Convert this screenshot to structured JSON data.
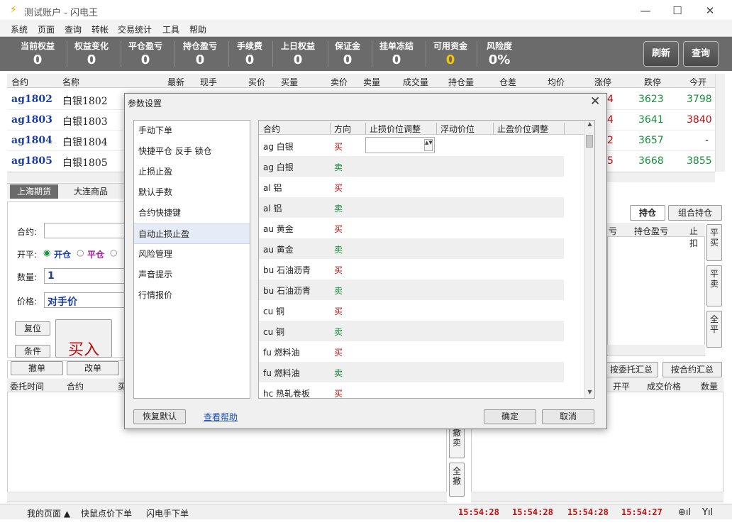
{
  "app": {
    "title": "测试账户 - 闪电王"
  },
  "menu": [
    "系统",
    "页面",
    "查询",
    "转帐",
    "交易统计",
    "工具",
    "帮助"
  ],
  "stats": [
    {
      "label": "当前权益",
      "value": "0"
    },
    {
      "label": "权益变化",
      "value": "0"
    },
    {
      "label": "平仓盈亏",
      "value": "0"
    },
    {
      "label": "持仓盈亏",
      "value": "0"
    },
    {
      "label": "手续费",
      "value": "0"
    },
    {
      "label": "上日权益",
      "value": "0"
    },
    {
      "label": "保证金",
      "value": "0"
    },
    {
      "label": "挂单冻结",
      "value": "0"
    },
    {
      "label": "可用资金",
      "value": "0"
    },
    {
      "label": "风险度",
      "value": "0%"
    }
  ],
  "dash_buttons": {
    "refresh": "刷新",
    "query": "查询"
  },
  "quote": {
    "headers": [
      "合约",
      "名称",
      "最新",
      "现手",
      "买价",
      "买量",
      "卖价",
      "卖量",
      "成交量",
      "持仓量",
      "仓差",
      "均价",
      "涨停",
      "跌停",
      "今开"
    ],
    "rows": [
      {
        "code": "ag1802",
        "name": "白银1802",
        "up": "4",
        "down": "3623",
        "open": "3798"
      },
      {
        "code": "ag1803",
        "name": "白银1803",
        "up": "4",
        "down": "3641",
        "open": "3840"
      },
      {
        "code": "ag1804",
        "name": "白银1804",
        "up": "2",
        "down": "3657",
        "open": "-"
      },
      {
        "code": "ag1805",
        "name": "白银1805",
        "up": "5",
        "down": "3668",
        "open": "3855"
      }
    ]
  },
  "market_tabs": [
    "上海期货",
    "大连商品"
  ],
  "order": {
    "contract_label": "合约:",
    "openclose_label": "开平:",
    "open": "开仓",
    "close": "平仓",
    "qty_label": "数量:",
    "qty": "1",
    "price_label": "价格:",
    "price": "对手价",
    "reset": "复位",
    "cond": "条件",
    "buy": "买入"
  },
  "pos_tabs": [
    "持仓",
    "组合持仓"
  ],
  "pos_headers": [
    "亏",
    "持仓盈亏",
    "止扣"
  ],
  "side_buttons": [
    "平买",
    "平卖",
    "全平"
  ],
  "order_buttons": [
    "撤单",
    "改单"
  ],
  "order_headers": [
    "委托时间",
    "合约",
    "买"
  ],
  "cancel_buttons": [
    "撤卖",
    "全撤"
  ],
  "trade_tabs": [
    "按委托汇总",
    "按合约汇总"
  ],
  "trade_headers": [
    "开平",
    "成交价格",
    "数量"
  ],
  "status": {
    "items": [
      "我的页面 ▲",
      "快鼠点价下单",
      "闪电手下单"
    ],
    "times": [
      "15:54:28",
      "15:54:28",
      "15:54:28",
      "15:54:27"
    ]
  },
  "dialog": {
    "title": "参数设置",
    "menu": [
      "手动下单",
      "快捷平仓 反手 锁仓",
      "止损止盈",
      "默认手数",
      "合约快捷键",
      "自动止损止盈",
      "风险管理",
      "声音提示",
      "行情报价"
    ],
    "selected": 5,
    "grid_headers": [
      "合约",
      "方向",
      "止损价位调整",
      "浮动价位",
      "止盈价位调整"
    ],
    "rows": [
      {
        "contract": "ag 白银",
        "dir": "买"
      },
      {
        "contract": "ag 白银",
        "dir": "卖"
      },
      {
        "contract": "al 铝",
        "dir": "买"
      },
      {
        "contract": "al 铝",
        "dir": "卖"
      },
      {
        "contract": "au 黄金",
        "dir": "买"
      },
      {
        "contract": "au 黄金",
        "dir": "卖"
      },
      {
        "contract": "bu 石油沥青",
        "dir": "买"
      },
      {
        "contract": "bu 石油沥青",
        "dir": "卖"
      },
      {
        "contract": "cu 铜",
        "dir": "买"
      },
      {
        "contract": "cu 铜",
        "dir": "卖"
      },
      {
        "contract": "fu 燃料油",
        "dir": "买"
      },
      {
        "contract": "fu 燃料油",
        "dir": "卖"
      },
      {
        "contract": "hc 热轧卷板",
        "dir": "买"
      }
    ],
    "restore": "恢复默认",
    "help": "查看帮助",
    "ok": "确定",
    "cancel": "取消"
  },
  "colors": {
    "buy": "#c01010",
    "sell": "#14903a",
    "accent": "#1a3ca8"
  }
}
